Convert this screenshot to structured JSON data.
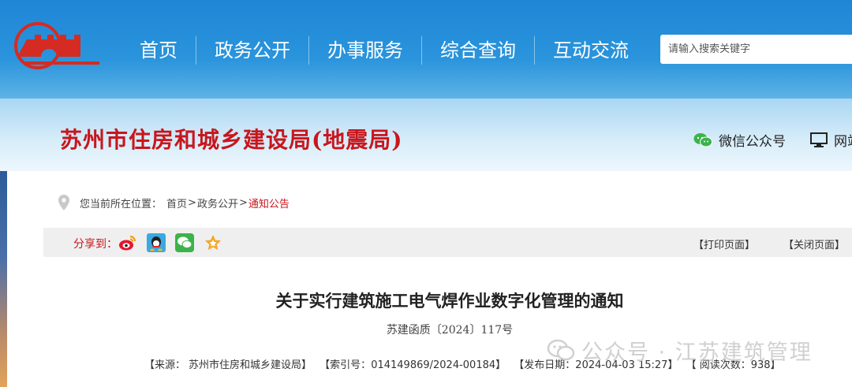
{
  "nav": {
    "items": [
      "首页",
      "政务公开",
      "办事服务",
      "综合查询",
      "互动交流"
    ]
  },
  "search": {
    "placeholder": "请输入搜索关键字"
  },
  "site_title": "苏州市住房和城乡建设局(地震局)",
  "header_links": {
    "wechat": "微信公众号",
    "web": "网站"
  },
  "breadcrumb": {
    "prefix": "您当前所在位置：",
    "items": [
      "首页",
      "政务公开",
      "通知公告"
    ]
  },
  "share": {
    "label": "分享到：",
    "print": "【打印页面】",
    "close": "【关闭页面】"
  },
  "article": {
    "title": "关于实行建筑施工电气焊作业数字化管理的通知",
    "doc_number": "苏建函质〔2024〕117号",
    "source_label": "【来源：",
    "source": "苏州市住房和城乡建设局】",
    "index_label": "【索引号：",
    "index": "014149869/2024-00184】",
    "date_label": "【发布日期：",
    "date": "2024-04-03 15:27】",
    "views_label": "【 阅读次数：",
    "views": "938】"
  },
  "watermark": "公众号 · 江苏建筑管理",
  "colors": {
    "nav_bg": "#1f86d6",
    "accent_red": "#c8161d",
    "share_bar": "#efefef"
  }
}
